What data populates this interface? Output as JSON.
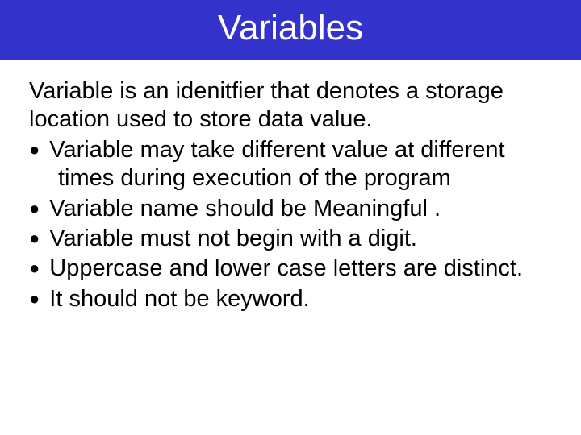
{
  "title": "Variables",
  "intro": "Variable is an idenitfier that denotes a storage location used to store data value.",
  "bullets": {
    "b1": "Variable may take different value at different times during execution of the program",
    "b2": "Variable name should be Meaningful .",
    "b3": "Variable must not begin with a digit.",
    "b4": "Uppercase and lower case letters are distinct.",
    "b5": "It should not be keyword."
  }
}
